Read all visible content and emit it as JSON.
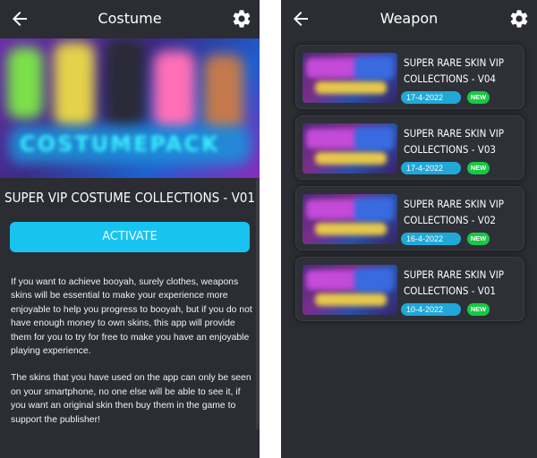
{
  "colors": {
    "background": "#2b2d33",
    "accent": "#18c3f0",
    "date_badge": "#1fa8d8",
    "new_badge": "#18c845"
  },
  "left_screen": {
    "header": {
      "title": "Costume",
      "back_icon": "arrow-left-icon",
      "settings_icon": "gear-icon"
    },
    "item_title": "SUPER VIP COSTUME COLLECTIONS - V01",
    "activate_label": "ACTIVATE",
    "description": [
      "If you want to achieve booyah, surely clothes, weapons skins will be essential to make your experience more enjoyable to help you progress to booyah, but if you do not have enough money to own skins, this app will provide them for you to try for free to make you have an enjoyable playing experience.",
      "The skins that you have used on the app can only be seen on your smartphone, no one else will be able to see it, if you want an original skin then buy them in the game to support the publisher!"
    ]
  },
  "right_screen": {
    "header": {
      "title": "Weapon",
      "back_icon": "arrow-left-icon",
      "settings_icon": "gear-icon"
    },
    "items": [
      {
        "title": "SUPER RARE SKIN VIP COLLECTIONS - V04",
        "date": "17-4-2022",
        "badge": "NEW"
      },
      {
        "title": "SUPER RARE SKIN VIP COLLECTIONS - V03",
        "date": "17-4-2022",
        "badge": "NEW"
      },
      {
        "title": "SUPER RARE SKIN VIP COLLECTIONS - V02",
        "date": "16-4-2022",
        "badge": "NEW"
      },
      {
        "title": "SUPER RARE SKIN VIP COLLECTIONS - V01",
        "date": "10-4-2022",
        "badge": "NEW"
      }
    ]
  }
}
